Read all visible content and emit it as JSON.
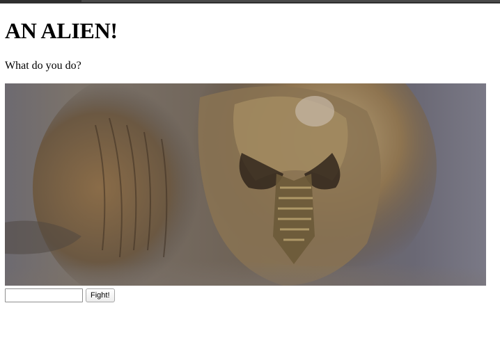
{
  "page": {
    "heading": "AN ALIEN!",
    "prompt": "What do you do?"
  },
  "image": {
    "subject": "alien-creature-photo"
  },
  "form": {
    "input_value": "",
    "input_placeholder": "",
    "fight_label": "Fight!"
  },
  "colors": {
    "top_bar": "#2f2f2f",
    "page_background": "#ffffff",
    "text": "#000000"
  }
}
